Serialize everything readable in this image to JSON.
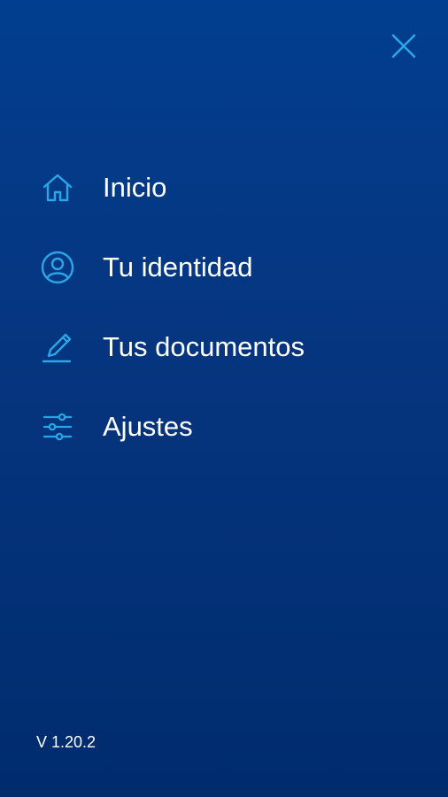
{
  "colors": {
    "accent": "#2aa6e8",
    "background_top": "#023e8f",
    "background_bottom": "#002c6e",
    "text": "#ffffff"
  },
  "header": {
    "close_icon": "close-icon"
  },
  "menu": {
    "items": [
      {
        "label": "Inicio",
        "icon": "home-icon"
      },
      {
        "label": "Tu identidad",
        "icon": "user-circle-icon"
      },
      {
        "label": "Tus documentos",
        "icon": "pen-icon"
      },
      {
        "label": "Ajustes",
        "icon": "sliders-icon"
      }
    ]
  },
  "footer": {
    "version": "V 1.20.2"
  }
}
